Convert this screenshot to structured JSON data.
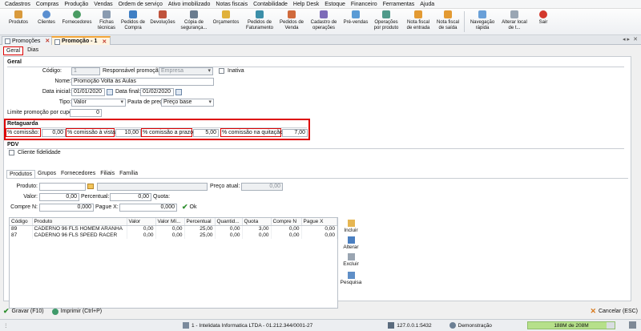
{
  "menu": [
    "Cadastros",
    "Compras",
    "Produção",
    "Vendas",
    "Ordem de serviço",
    "Ativo imobilizado",
    "Notas fiscais",
    "Contabilidade",
    "Help Desk",
    "Estoque",
    "Financeiro",
    "Ferramentas",
    "Ajuda"
  ],
  "toolbar": {
    "produtos": "Produtos",
    "clientes": "Clientes",
    "fornecedores": "Fornecedores",
    "fichas1": "Fichas",
    "fichas2": "técnicas",
    "pedidos_compra1": "Pedidos de",
    "pedidos_compra2": "Compra",
    "devolucoes": "Devoluções",
    "copia1": "Cópia de",
    "copia2": "segurança...",
    "orcamentos": "Orçamentos",
    "pfat1": "Pedidos de",
    "pfat2": "Faturamento",
    "pvenda1": "Pedidos de",
    "pvenda2": "Venda",
    "cadop1": "Cadastro de",
    "cadop2": "operações",
    "prevendas": "Pré-vendas",
    "opprod1": "Operações",
    "opprod2": "por produto",
    "nfe1": "Nota fiscal",
    "nfe2": "de entrada",
    "nfs1": "Nota fiscal",
    "nfs2": "de saída",
    "nav1": "Navegação",
    "nav2": "rápida",
    "alterar1": "Alterar local",
    "alterar2": "de t...",
    "sair": "Sair"
  },
  "doc_tabs": {
    "promocoes": "Promoções",
    "promocao1": "Promoção - 1"
  },
  "sub_tabs": {
    "geral": "Geral",
    "dias": "Dias"
  },
  "geral": {
    "section": "Geral",
    "codigo_label": "Código:",
    "codigo": "1",
    "responsavel_label": "Responsável promoção:",
    "responsavel": "Empresa",
    "inativa_label": "Inativa",
    "nome_label": "Nome:",
    "nome": "Promoção Volta às Aulas",
    "data_inicial_label": "Data inicial:",
    "data_inicial": "01/01/2020",
    "data_final_label": "Data final:",
    "data_final": "01/02/2020",
    "tipo_label": "Tipo:",
    "tipo": "Valor",
    "pauta_label": "Pauta de preço:",
    "pauta": "Preço base",
    "limite_label": "Limite promoção por cupom:",
    "limite": "0"
  },
  "retaguarda": {
    "section": "Retaguarda",
    "comissao_label": "% comissão:",
    "comissao": "0,00",
    "vista_label": "% comissão à vista:",
    "vista": "10,00",
    "prazo_label": "% comissão a prazo:",
    "prazo": "5,00",
    "quitacao_label": "% comissão na quitação:",
    "quitacao": "7,00"
  },
  "pdv": {
    "section": "PDV",
    "fidelidade_label": "Cliente fidelidade"
  },
  "inner_tabs": [
    "Produtos",
    "Grupos",
    "Fornecedores",
    "Filiais",
    "Família"
  ],
  "product_form": {
    "produto_label": "Produto:",
    "preco_atual_label": "Preço atual:",
    "preco_atual": "0,00",
    "valor_label": "Valor:",
    "valor": "0,00",
    "percentual_label": "Percentual:",
    "percentual": "0,00",
    "quota_label": "Quota:",
    "compre_label": "Compre N:",
    "compre": "0,000",
    "pague_label": "Pague X:",
    "pague": "0,000",
    "ok": "Ok"
  },
  "grid": {
    "columns": [
      "Código",
      "Produto",
      "Valor",
      "Valor Mí...",
      "Percentual",
      "Quantid...",
      "Quota",
      "Compre N",
      "Pague X"
    ],
    "rows": [
      [
        "89",
        "CADERNO 96 FLS HOMEM ARANHA",
        "0,00",
        "0,00",
        "25,00",
        "0,00",
        "3,00",
        "0,00",
        "0,00"
      ],
      [
        "87",
        "CADERNO 96 FLS SPEED RACER",
        "0,00",
        "0,00",
        "25,00",
        "0,00",
        "0,00",
        "0,00",
        "0,00"
      ]
    ]
  },
  "side_buttons": {
    "incluir": "Incluir",
    "alterar": "Alterar",
    "excluir": "Excluir",
    "pesquisa": "Pesquisa"
  },
  "bottom": {
    "gravar": "Gravar (F10)",
    "imprimir": "Imprimir (Ctrl+P)",
    "cancelar": "Cancelar (ESC)"
  },
  "status": {
    "company": "1 - Intelidata Informatica LTDA - 01.212.344/0001-27",
    "server": "127.0.0.1:5432",
    "mode": "Demonstração",
    "memory": "188M de 208M",
    "memory_fraction": 0.904
  }
}
